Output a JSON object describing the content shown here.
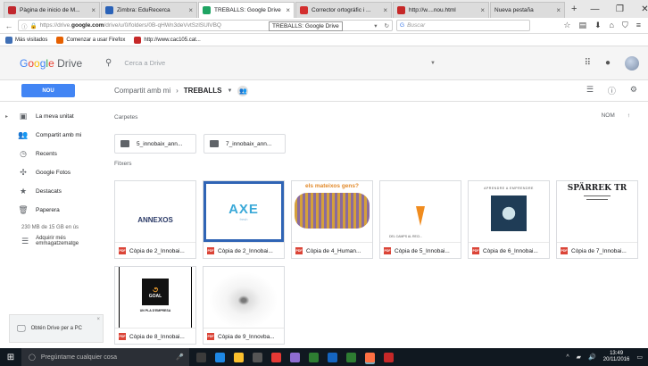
{
  "browser": {
    "tabs": [
      {
        "label": "Pàgina de inicio de M...",
        "color": "#c1272d",
        "active": false
      },
      {
        "label": "Zimbra: EduRecerca",
        "color": "#2a62b8",
        "active": false
      },
      {
        "label": "TREBALLS: Google Drive",
        "color": "#1fa463",
        "active": true
      },
      {
        "label": "Corrector ortográfic i ...",
        "color": "#d32f2f",
        "active": false
      },
      {
        "label": "http://w....nou.html",
        "color": "#c62828",
        "active": false
      },
      {
        "label": "Nueva pestaña",
        "color": "",
        "active": false
      }
    ],
    "url_prefix": "https://drive.",
    "url_domain": "google.com",
    "url_suffix": "/drive/u/0/folders/0B-qHWn3deVvtSzlSUlVBQ",
    "url_tooltip": "TREBALLS: Google Drive",
    "search_placeholder": "Buscar",
    "bookmarks": [
      {
        "label": "Más visitados",
        "color": "#3f6fb5"
      },
      {
        "label": "Comenzar a usar Firefox",
        "color": "#e66000"
      },
      {
        "label": "http://www.cac105.cat...",
        "color": "#c62828"
      }
    ]
  },
  "drive": {
    "logo_g": "G",
    "logo_o1": "o",
    "logo_o2": "o",
    "logo_g2": "g",
    "logo_l": "l",
    "logo_e": "e",
    "logo_product": "Drive",
    "search_placeholder": "Cerca a Drive",
    "new_button": "NOU",
    "breadcrumb_parent": "Compartit amb mi",
    "breadcrumb_current": "TREBALLS",
    "sidebar": [
      {
        "label": "La meva unitat",
        "icon": "▣",
        "arrow": "▸"
      },
      {
        "label": "Compartit amb mi",
        "icon": "👥",
        "arrow": ""
      },
      {
        "label": "Recents",
        "icon": "◷",
        "arrow": ""
      },
      {
        "label": "Google Fotos",
        "icon": "✣",
        "arrow": ""
      },
      {
        "label": "Destacats",
        "icon": "★",
        "arrow": ""
      },
      {
        "label": "Paperera",
        "icon": "🗑",
        "arrow": ""
      }
    ],
    "storage_text": "230 MB de 15 GB en ús",
    "buy_storage": "Adquirir més emmagatzematge",
    "get_drive": "Obtén Drive per a PC",
    "folders_title": "Carpetes",
    "files_title": "Fitxers",
    "sort_label": "NOM",
    "folders": [
      "5_innobaix_ann...",
      "7_innobaix_ann..."
    ],
    "files": [
      {
        "caption": "Còpia de 2_Innobai...",
        "thumb": "annexos",
        "thumb_text": "ANNEXOS"
      },
      {
        "caption": "Còpia de 2_Innobai...",
        "thumb": "axe",
        "thumb_text": "AXE",
        "thumb_sub": "fresh"
      },
      {
        "caption": "Còpia de 4_Human...",
        "thumb": "gens",
        "thumb_text": "els mateixos gens?"
      },
      {
        "caption": "Còpia de 5_Innobai...",
        "thumb": "carrot",
        "thumb_text": "DEL CAMPS AL RECI..."
      },
      {
        "caption": "Còpia de 6_Innobai...",
        "thumb": "aprendre",
        "thumb_text": "APRENDRE A EMPRENDRE"
      },
      {
        "caption": "Còpia de 7_Innobai...",
        "thumb": "sparrek",
        "thumb_text": "SPÄRREK TR"
      },
      {
        "caption": "Còpia de 8_Innobai...",
        "thumb": "goal",
        "thumb_text": "GOAL",
        "thumb_sub": "UN PLA D'EMPRESA"
      },
      {
        "caption": "Còpia de 9_Innovba...",
        "thumb": "splash",
        "thumb_text": ""
      }
    ]
  },
  "taskbar": {
    "search_placeholder": "Pregúntame cualquier cosa",
    "time": "13:49",
    "date": "20/11/2016",
    "apps": [
      "#3b3b3b",
      "#1e88e5",
      "#fbc02d",
      "#555555",
      "#e53935",
      "#8e6cd1",
      "#2e7d32",
      "#1565c0",
      "#2e7d32",
      "#ff7043",
      "#c62828"
    ]
  }
}
